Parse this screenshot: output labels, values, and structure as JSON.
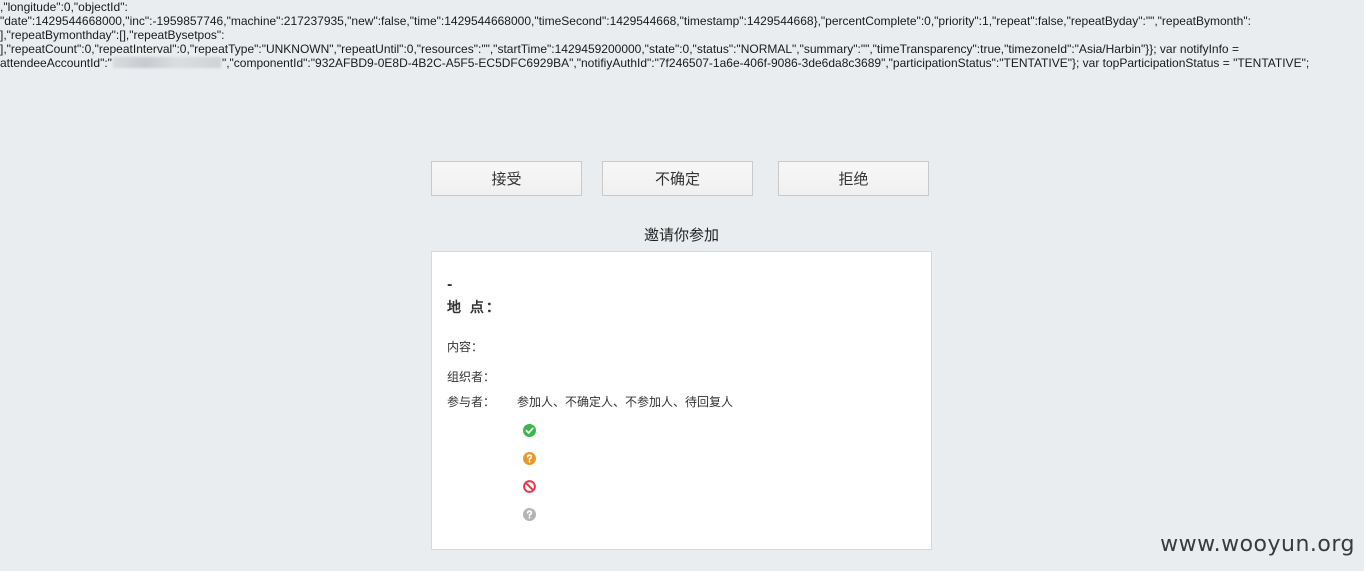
{
  "code_dump": {
    "line1": ",\"longitude\":0,\"objectId\":",
    "line2": "\"date\":1429544668000,\"inc\":-1959857746,\"machine\":217237935,\"new\":false,\"time\":1429544668000,\"timeSecond\":1429544668,\"timestamp\":1429544668},\"percentComplete\":0,\"priority\":1,\"repeat\":false,\"repeatByday\":\"\",\"repeatBymonth\":",
    "line3": "],\"repeatBymonthday\":[],\"repeatBysetpos\":",
    "line4": "],\"repeatCount\":0,\"repeatInterval\":0,\"repeatType\":\"UNKNOWN\",\"repeatUntil\":0,\"resources\":\"\",\"startTime\":1429459200000,\"state\":0,\"status\":\"NORMAL\",\"summary\":\"\",\"timeTransparency\":true,\"timezoneId\":\"Asia/Harbin\"}}; var notifyInfo =",
    "line5_before": "attendeeAccountId\":\"",
    "line5_after": "\",\"componentId\":\"932AFBD9-0E8D-4B2C-A5F5-EC5DFC6929BA\",\"notifiyAuthId\":\"7f246507-1a6e-406f-9086-3de6da8c3689\",\"participationStatus\":\"TENTATIVE\"}; var topParticipationStatus = \"TENTATIVE\";"
  },
  "actions": {
    "accept_label": "接受",
    "tentative_label": "不确定",
    "decline_label": "拒绝"
  },
  "invite": {
    "title": "邀请你参加",
    "time_dash": "-",
    "location_label": "地 点：",
    "content_label": "内容：",
    "organizer_label": "组织者：",
    "attendees_label": "参与者：",
    "attendees_legend": "参加人、不确定人、不参加人、待回复人"
  },
  "status_icons": [
    {
      "name": "accepted-check-icon",
      "color": "#3cb54a"
    },
    {
      "name": "tentative-question-icon",
      "color": "#e79a2b"
    },
    {
      "name": "declined-ban-icon",
      "color": "#e23b4b"
    },
    {
      "name": "pending-question-icon",
      "color": "#b4b4b4"
    }
  ],
  "watermark": "www.wooyun.org"
}
